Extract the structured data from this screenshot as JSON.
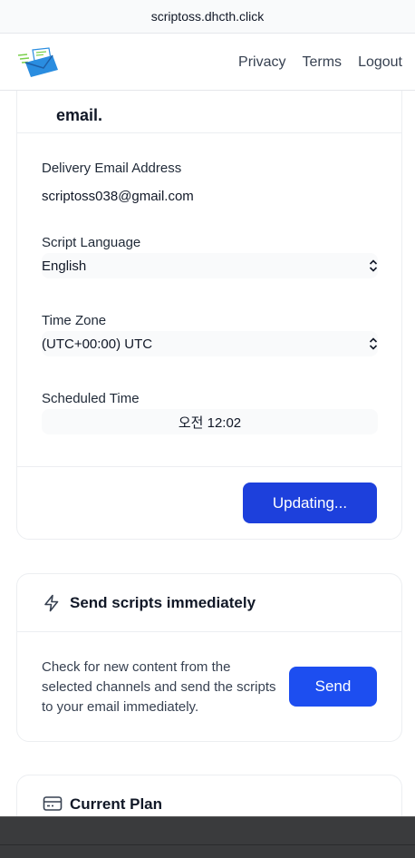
{
  "browser": {
    "url": "scriptoss.dhcth.click"
  },
  "nav": {
    "privacy": "Privacy",
    "terms": "Terms",
    "logout": "Logout"
  },
  "settings_card": {
    "heading_fragment": "email.",
    "delivery_label": "Delivery Email Address",
    "delivery_value": "scriptoss038@gmail.com",
    "language_label": "Script Language",
    "language_value": "English",
    "timezone_label": "Time Zone",
    "timezone_value": "(UTC+00:00) UTC",
    "time_label": "Scheduled Time",
    "time_value": "오전 12:02",
    "submit_label": "Updating..."
  },
  "send_card": {
    "title": "Send scripts immediately",
    "description": "Check for new content from the selected channels and send the scripts to your email immediately.",
    "button_label": "Send"
  },
  "plan_card": {
    "title": "Current Plan"
  },
  "colors": {
    "primary": "#1d40dc",
    "send": "#1d4ef0",
    "logo_blue": "#2a8de0",
    "logo_green": "#7ad04b"
  }
}
